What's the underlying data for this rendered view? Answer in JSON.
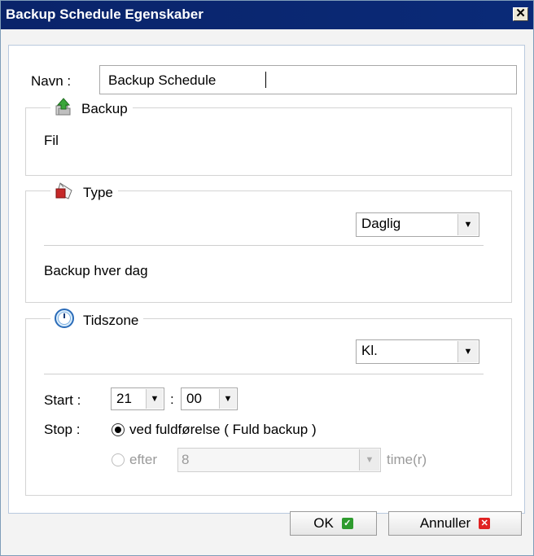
{
  "window": {
    "title": "Backup Schedule Egenskaber",
    "close_glyph": "✕"
  },
  "name_field": {
    "label": "Navn :",
    "value": "Backup Schedule"
  },
  "backup_group": {
    "legend": "Backup",
    "icon": "backup-icon",
    "content": "Fil"
  },
  "type_group": {
    "legend": "Type",
    "icon": "type-icon",
    "select_value": "Daglig",
    "description": "Backup hver dag"
  },
  "timezone_group": {
    "legend": "Tidszone",
    "icon": "clock-icon",
    "select_value": "Kl.",
    "start_label": "Start :",
    "start_hour": "21",
    "time_separator": ":",
    "start_minute": "00",
    "stop_label": "Stop :",
    "stop_option_1": "ved fuldførelse ( Fuld backup )",
    "stop_option_2_label": "efter",
    "stop_option_2_value": "8",
    "stop_option_2_unit": "time(r)"
  },
  "buttons": {
    "ok": "OK",
    "cancel": "Annuller"
  },
  "colors": {
    "title_bar": "#0a246a",
    "ok_check": "#2e9b2e",
    "cancel_x": "#e02222"
  }
}
